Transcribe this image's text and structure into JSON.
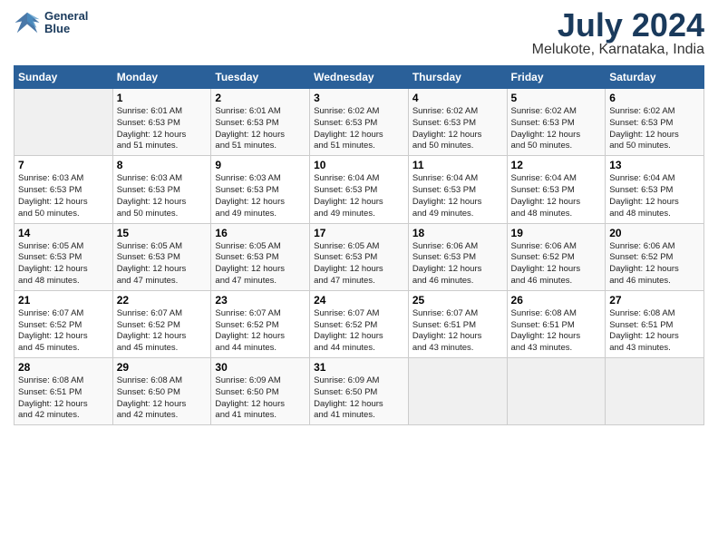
{
  "header": {
    "logo_line1": "General",
    "logo_line2": "Blue",
    "title": "July 2024",
    "subtitle": "Melukote, Karnataka, India"
  },
  "calendar": {
    "weekdays": [
      "Sunday",
      "Monday",
      "Tuesday",
      "Wednesday",
      "Thursday",
      "Friday",
      "Saturday"
    ],
    "weeks": [
      [
        {
          "day": "",
          "info": ""
        },
        {
          "day": "1",
          "info": "Sunrise: 6:01 AM\nSunset: 6:53 PM\nDaylight: 12 hours\nand 51 minutes."
        },
        {
          "day": "2",
          "info": "Sunrise: 6:01 AM\nSunset: 6:53 PM\nDaylight: 12 hours\nand 51 minutes."
        },
        {
          "day": "3",
          "info": "Sunrise: 6:02 AM\nSunset: 6:53 PM\nDaylight: 12 hours\nand 51 minutes."
        },
        {
          "day": "4",
          "info": "Sunrise: 6:02 AM\nSunset: 6:53 PM\nDaylight: 12 hours\nand 50 minutes."
        },
        {
          "day": "5",
          "info": "Sunrise: 6:02 AM\nSunset: 6:53 PM\nDaylight: 12 hours\nand 50 minutes."
        },
        {
          "day": "6",
          "info": "Sunrise: 6:02 AM\nSunset: 6:53 PM\nDaylight: 12 hours\nand 50 minutes."
        }
      ],
      [
        {
          "day": "7",
          "info": "Sunrise: 6:03 AM\nSunset: 6:53 PM\nDaylight: 12 hours\nand 50 minutes."
        },
        {
          "day": "8",
          "info": "Sunrise: 6:03 AM\nSunset: 6:53 PM\nDaylight: 12 hours\nand 50 minutes."
        },
        {
          "day": "9",
          "info": "Sunrise: 6:03 AM\nSunset: 6:53 PM\nDaylight: 12 hours\nand 49 minutes."
        },
        {
          "day": "10",
          "info": "Sunrise: 6:04 AM\nSunset: 6:53 PM\nDaylight: 12 hours\nand 49 minutes."
        },
        {
          "day": "11",
          "info": "Sunrise: 6:04 AM\nSunset: 6:53 PM\nDaylight: 12 hours\nand 49 minutes."
        },
        {
          "day": "12",
          "info": "Sunrise: 6:04 AM\nSunset: 6:53 PM\nDaylight: 12 hours\nand 48 minutes."
        },
        {
          "day": "13",
          "info": "Sunrise: 6:04 AM\nSunset: 6:53 PM\nDaylight: 12 hours\nand 48 minutes."
        }
      ],
      [
        {
          "day": "14",
          "info": "Sunrise: 6:05 AM\nSunset: 6:53 PM\nDaylight: 12 hours\nand 48 minutes."
        },
        {
          "day": "15",
          "info": "Sunrise: 6:05 AM\nSunset: 6:53 PM\nDaylight: 12 hours\nand 47 minutes."
        },
        {
          "day": "16",
          "info": "Sunrise: 6:05 AM\nSunset: 6:53 PM\nDaylight: 12 hours\nand 47 minutes."
        },
        {
          "day": "17",
          "info": "Sunrise: 6:05 AM\nSunset: 6:53 PM\nDaylight: 12 hours\nand 47 minutes."
        },
        {
          "day": "18",
          "info": "Sunrise: 6:06 AM\nSunset: 6:53 PM\nDaylight: 12 hours\nand 46 minutes."
        },
        {
          "day": "19",
          "info": "Sunrise: 6:06 AM\nSunset: 6:52 PM\nDaylight: 12 hours\nand 46 minutes."
        },
        {
          "day": "20",
          "info": "Sunrise: 6:06 AM\nSunset: 6:52 PM\nDaylight: 12 hours\nand 46 minutes."
        }
      ],
      [
        {
          "day": "21",
          "info": "Sunrise: 6:07 AM\nSunset: 6:52 PM\nDaylight: 12 hours\nand 45 minutes."
        },
        {
          "day": "22",
          "info": "Sunrise: 6:07 AM\nSunset: 6:52 PM\nDaylight: 12 hours\nand 45 minutes."
        },
        {
          "day": "23",
          "info": "Sunrise: 6:07 AM\nSunset: 6:52 PM\nDaylight: 12 hours\nand 44 minutes."
        },
        {
          "day": "24",
          "info": "Sunrise: 6:07 AM\nSunset: 6:52 PM\nDaylight: 12 hours\nand 44 minutes."
        },
        {
          "day": "25",
          "info": "Sunrise: 6:07 AM\nSunset: 6:51 PM\nDaylight: 12 hours\nand 43 minutes."
        },
        {
          "day": "26",
          "info": "Sunrise: 6:08 AM\nSunset: 6:51 PM\nDaylight: 12 hours\nand 43 minutes."
        },
        {
          "day": "27",
          "info": "Sunrise: 6:08 AM\nSunset: 6:51 PM\nDaylight: 12 hours\nand 43 minutes."
        }
      ],
      [
        {
          "day": "28",
          "info": "Sunrise: 6:08 AM\nSunset: 6:51 PM\nDaylight: 12 hours\nand 42 minutes."
        },
        {
          "day": "29",
          "info": "Sunrise: 6:08 AM\nSunset: 6:50 PM\nDaylight: 12 hours\nand 42 minutes."
        },
        {
          "day": "30",
          "info": "Sunrise: 6:09 AM\nSunset: 6:50 PM\nDaylight: 12 hours\nand 41 minutes."
        },
        {
          "day": "31",
          "info": "Sunrise: 6:09 AM\nSunset: 6:50 PM\nDaylight: 12 hours\nand 41 minutes."
        },
        {
          "day": "",
          "info": ""
        },
        {
          "day": "",
          "info": ""
        },
        {
          "day": "",
          "info": ""
        }
      ]
    ]
  }
}
